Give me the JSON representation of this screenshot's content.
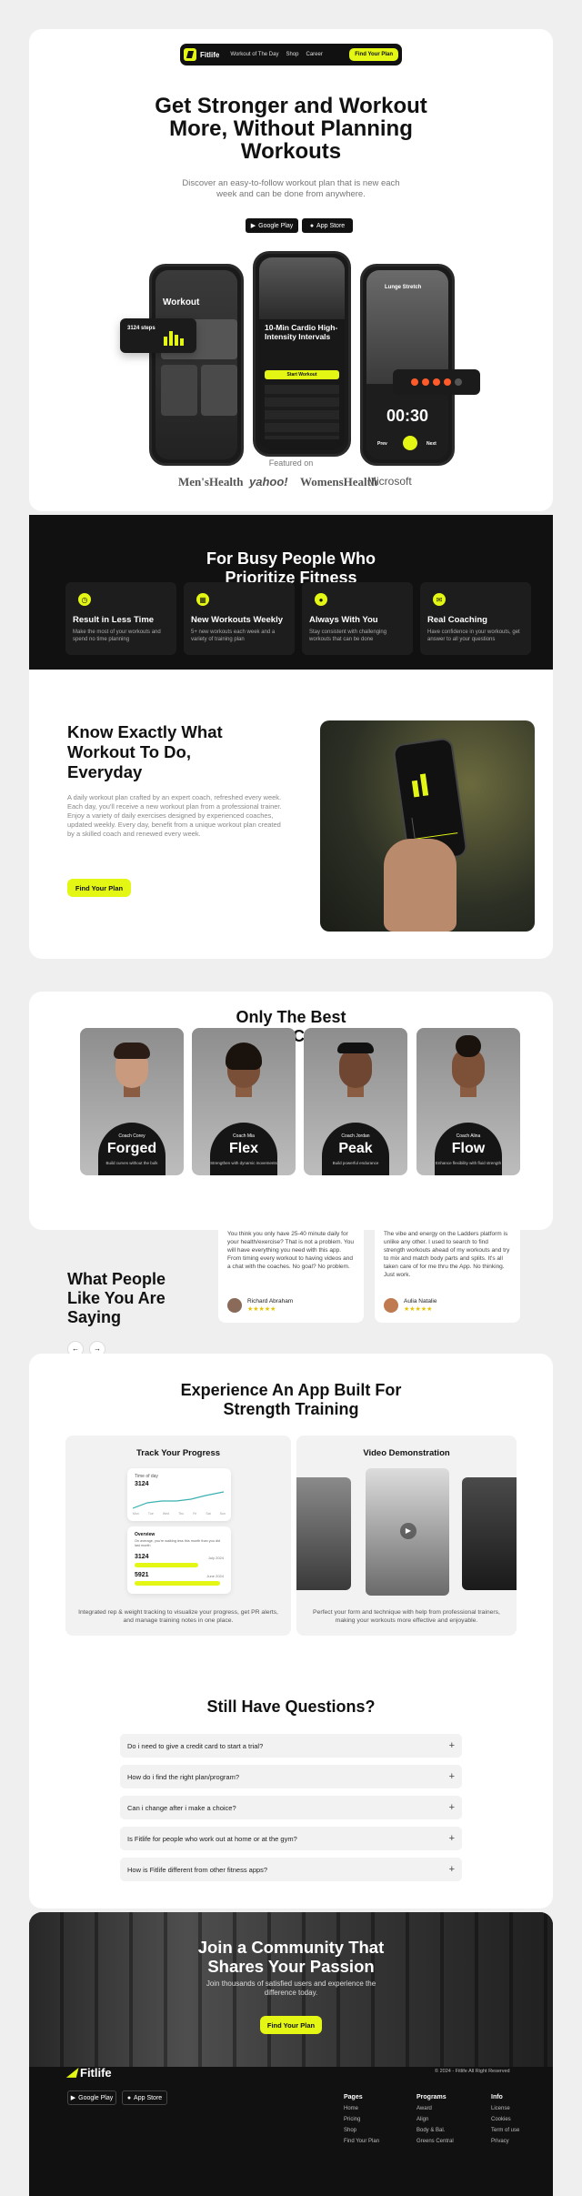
{
  "nav": {
    "logo": "Fitlife",
    "links": [
      "Workout of The Day",
      "Shop",
      "Career"
    ],
    "cta": "Find Your Plan"
  },
  "hero": {
    "title": "Get Stronger and Workout More, Without Planning Workouts",
    "subtitle": "Discover an easy-to-follow workout plan that is new each week and can be done from anywhere.",
    "google_play": "Google Play",
    "app_store": "App Store"
  },
  "phones": {
    "left_title": "Workout",
    "left_stat": "3124 steps",
    "mid_title": "10-Min Cardio High-Intensity Intervals",
    "mid_btn": "Start Workout",
    "right_title": "Lunge Stretch",
    "right_timer": "00:30",
    "right_prev": "Prev",
    "right_next": "Next"
  },
  "featured": {
    "label": "Featured on",
    "brands": [
      "Men'sHealth",
      "yahoo!",
      "WomensHealth",
      "Microsoft"
    ]
  },
  "busy": {
    "title": "For Busy People Who Prioritize Fitness",
    "features": [
      {
        "title": "Result in Less Time",
        "desc": "Make the most of your workouts and spend no time planning"
      },
      {
        "title": "New Workouts Weekly",
        "desc": "5+ new workouts each week and a variety of training plan"
      },
      {
        "title": "Always With You",
        "desc": "Stay consistent with challenging workouts that can be done"
      },
      {
        "title": "Real Coaching",
        "desc": "Have confidence in your workouts, get answer to all your questions"
      }
    ]
  },
  "know": {
    "title": "Know Exactly What Workout To Do, Everyday",
    "body": "A daily workout plan crafted by an expert coach, refreshed every week. Each day, you'll receive a new workout plan from a professional trainer. Enjoy a variety of daily exercises designed by experienced coaches, updated weekly. Every day, benefit from a unique workout plan created by a skilled coach and renewed every week.",
    "cta": "Find Your Plan"
  },
  "coaches": {
    "title": "Only The Best Strength Coaches",
    "items": [
      {
        "coach": "Coach Corey",
        "name": "Forged",
        "desc": "Build curves without the bulk"
      },
      {
        "coach": "Coach Mia",
        "name": "Flex",
        "desc": "Strengthen with dynamic movements"
      },
      {
        "coach": "Coach Jordan",
        "name": "Peak",
        "desc": "Build powerful endurance"
      },
      {
        "coach": "Coach Alina",
        "name": "Flow",
        "desc": "Enhance flexibility with fluid strength"
      }
    ]
  },
  "testimonials": {
    "title": "What People Like You Are Saying",
    "prev": "←",
    "next": "→",
    "items": [
      {
        "text": "You think you only have 25-40 minute daily for your health/exercise? That is not a problem. You will have everything you need with this app. From timing every workout to having videos and a chat with the coaches. No goal? No problem.",
        "name": "Richard Abraham",
        "stars": "★★★★★"
      },
      {
        "text": "The vibe and energy on the Ladders platform is unlike any other. I used to search to find strength workouts ahead of my workouts and try to mix and match body parts and splits. It's all taken care of for me thru the App. No thinking. Just work.",
        "name": "Aulia Natalie",
        "stars": "★★★★★"
      }
    ]
  },
  "experience": {
    "title": "Experience An App Built For Strength Training",
    "track": {
      "title": "Track Your Progress",
      "desc": "Integrated rep & weight tracking to visualize your progress, get PR alerts, and manage training notes in one place.",
      "time_label": "Time of day",
      "stat1": "3124",
      "chart_x": [
        "Mon",
        "Tue",
        "Wed",
        "Thu",
        "Fri",
        "Sat",
        "Sun"
      ],
      "overview": "Overview",
      "overview_text": "On average, you're walking less this month than you did last month",
      "stat2": "3124",
      "date1": "July 2024",
      "stat3": "5921",
      "date2": "June 2024"
    },
    "video": {
      "title": "Video Demonstration",
      "desc": "Perfect your form and technique with help from professional trainers, making your workouts more effective and enjoyable."
    }
  },
  "faq": {
    "title": "Still Have Questions?",
    "items": [
      "Do i need to give a credit card to start a trial?",
      "How do i find the right plan/program?",
      "Can i change after i make a choice?",
      "Is Fitlife for people who work out at home or at the gym?",
      "How is Fitlife different from other fitness apps?"
    ]
  },
  "community": {
    "title": "Join a Community That Shares Your Passion",
    "sub": "Join thousands of satisfied users and experience the difference today.",
    "cta": "Find Your Plan"
  },
  "footer": {
    "logo": "Fitlife",
    "copyright": "© 2024 - Fitlife  All Right Reserved",
    "google_play": "Google Play",
    "app_store": "App Store",
    "cols": [
      {
        "h": "Pages",
        "items": [
          "Home",
          "Pricing",
          "Shop",
          "Find Your Plan"
        ]
      },
      {
        "h": "Programs",
        "items": [
          "Award",
          "Align",
          "Body & Bal.",
          "Greens Central"
        ]
      },
      {
        "h": "Info",
        "items": [
          "License",
          "Cookies",
          "Term of use",
          "Privacy"
        ]
      }
    ]
  },
  "colors": {
    "accent": "#e4f714",
    "dark": "#111111"
  }
}
